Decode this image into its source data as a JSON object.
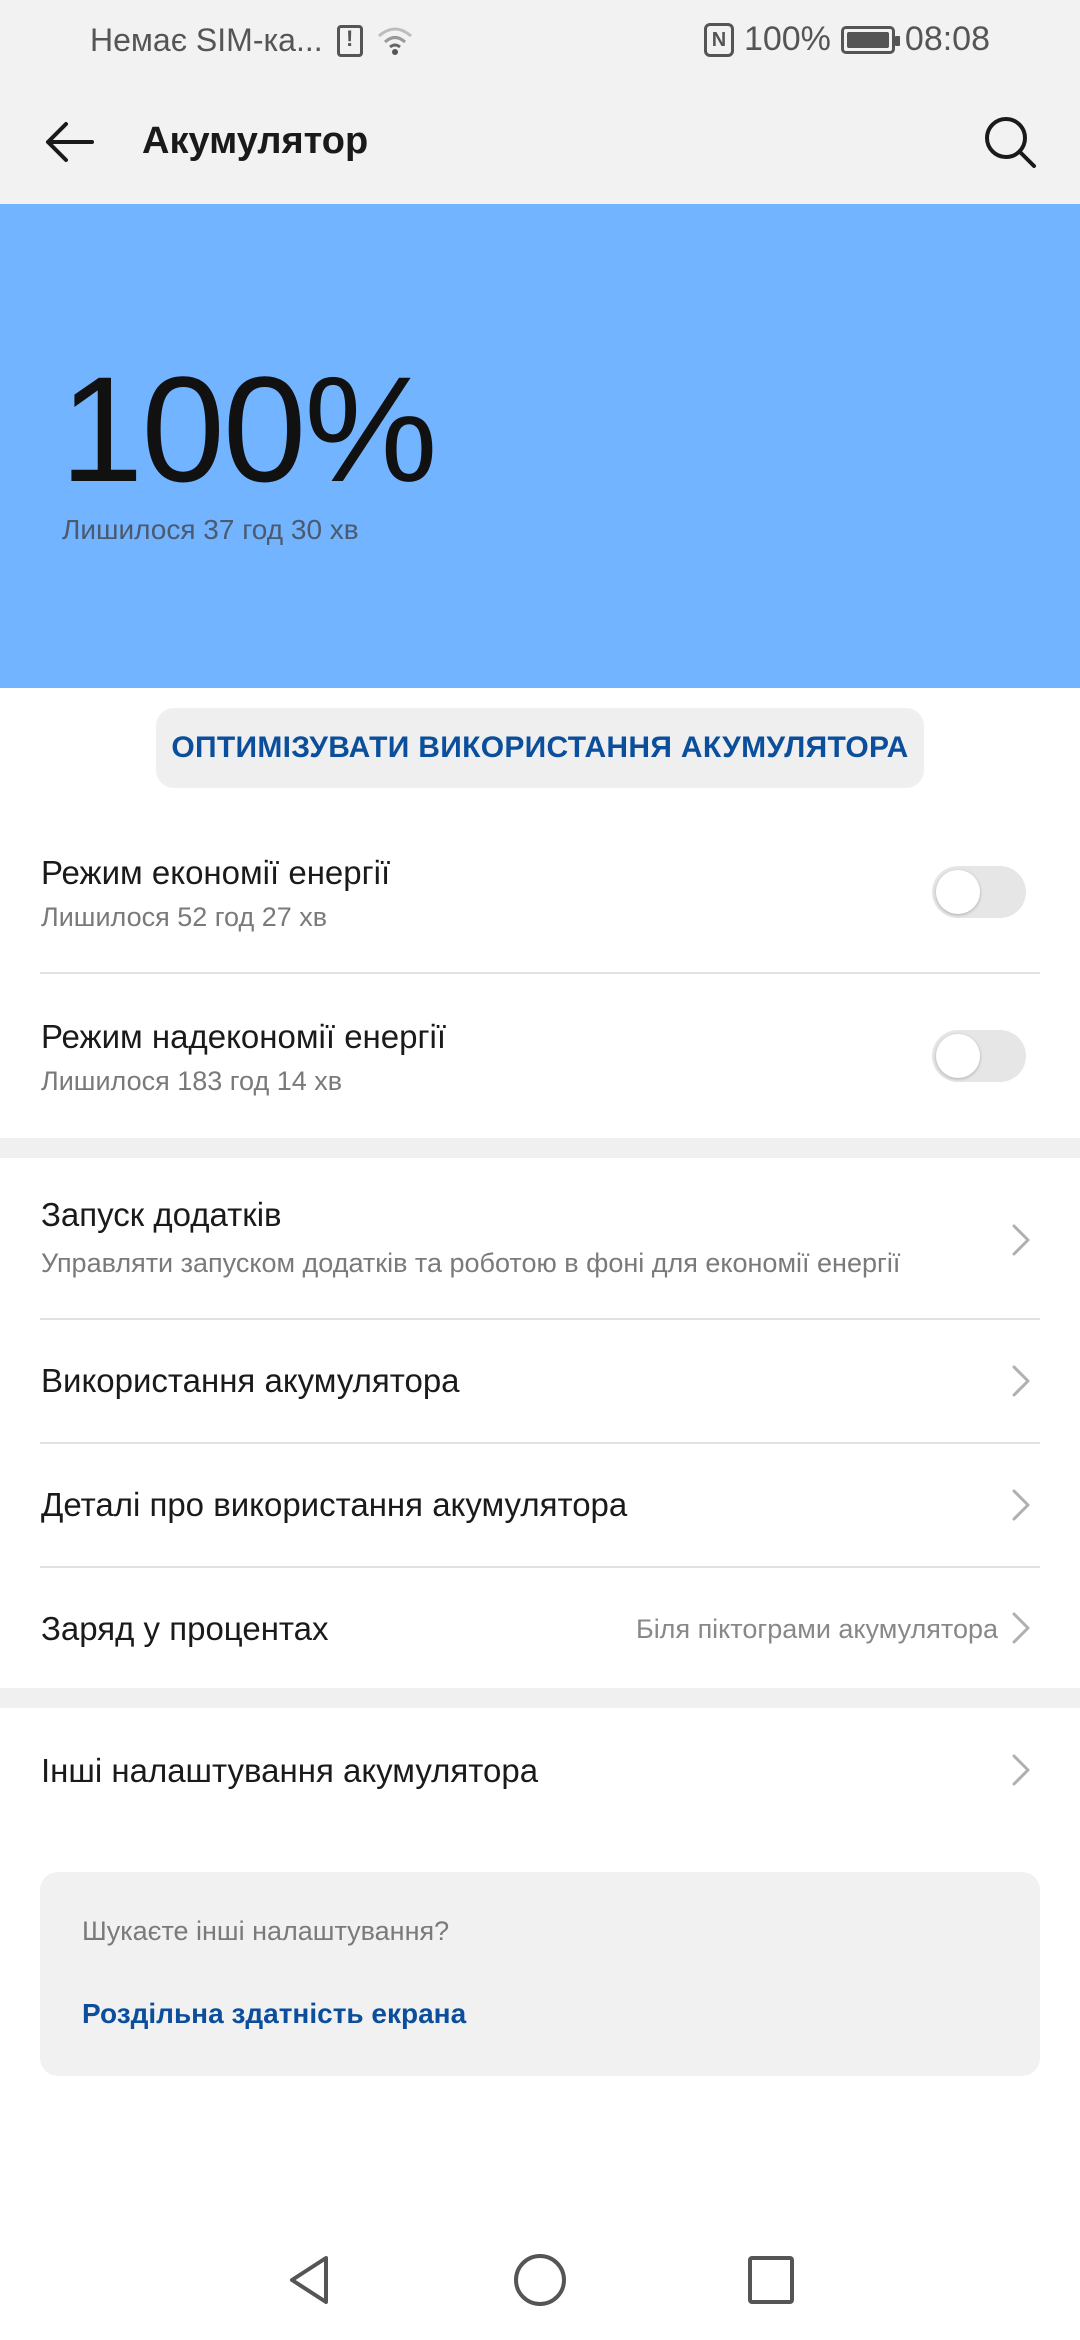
{
  "status_bar": {
    "carrier": "Немає SIM-ка...",
    "battery_percent": "100%",
    "time": "08:08"
  },
  "app_bar": {
    "title": "Акумулятор"
  },
  "hero": {
    "percent": "100%",
    "remaining": "Лишилося 37 год 30 хв",
    "background_color": "#72b4ff"
  },
  "optimize_button": {
    "label": "ОПТИМІЗУВАТИ ВИКОРИСТАННЯ АКУМУЛЯТОРА"
  },
  "power_modes": [
    {
      "title": "Режим економії енергії",
      "subtitle": "Лишилося 52 год 27 хв",
      "enabled": false
    },
    {
      "title": "Режим надекономії енергії",
      "subtitle": "Лишилося 183 год 14 хв",
      "enabled": false
    }
  ],
  "settings": [
    {
      "title": "Запуск додатків",
      "subtitle": "Управляти запуском додатків та роботою в фоні для економії енергії"
    },
    {
      "title": "Використання акумулятора"
    },
    {
      "title": "Деталі про використання акумулятора"
    },
    {
      "title": "Заряд у процентах",
      "value": "Біля піктограми акумулятора"
    }
  ],
  "more_settings": {
    "title": "Інші налаштування акумулятора"
  },
  "suggestion": {
    "title": "Шукаєте інші налаштування?",
    "link": "Роздільна здатність екрана"
  },
  "accent_color": "#0b4f9c"
}
